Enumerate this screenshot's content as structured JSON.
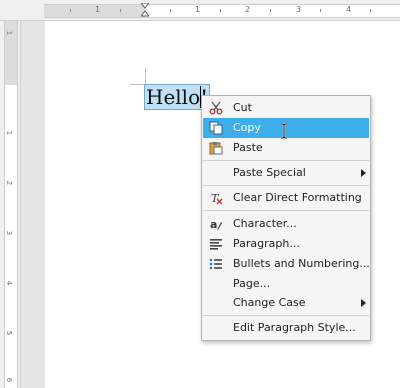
{
  "ruler": {
    "h_numbers": [
      "1",
      "1",
      "2",
      "3",
      "4"
    ],
    "v_numbers": [
      "1",
      "1",
      "2",
      "3",
      "4",
      "5",
      "6"
    ]
  },
  "document": {
    "text": "Hello!"
  },
  "context_menu": {
    "items": [
      {
        "label": "Cut",
        "icon": "scissors-icon"
      },
      {
        "label": "Copy",
        "icon": "copy-icon"
      },
      {
        "label": "Paste",
        "icon": "paste-icon"
      },
      {
        "label": "Paste Special",
        "submenu": true
      },
      {
        "label": "Clear Direct Formatting",
        "icon": "clear-formatting-icon"
      },
      {
        "label": "Character...",
        "icon": "character-icon"
      },
      {
        "label": "Paragraph...",
        "icon": "paragraph-icon"
      },
      {
        "label": "Bullets and Numbering...",
        "icon": "bullets-icon"
      },
      {
        "label": "Page..."
      },
      {
        "label": "Change Case",
        "submenu": true
      },
      {
        "label": "Edit Paragraph Style..."
      }
    ],
    "highlighted": "Copy",
    "highlight_color": "#3daee9"
  }
}
